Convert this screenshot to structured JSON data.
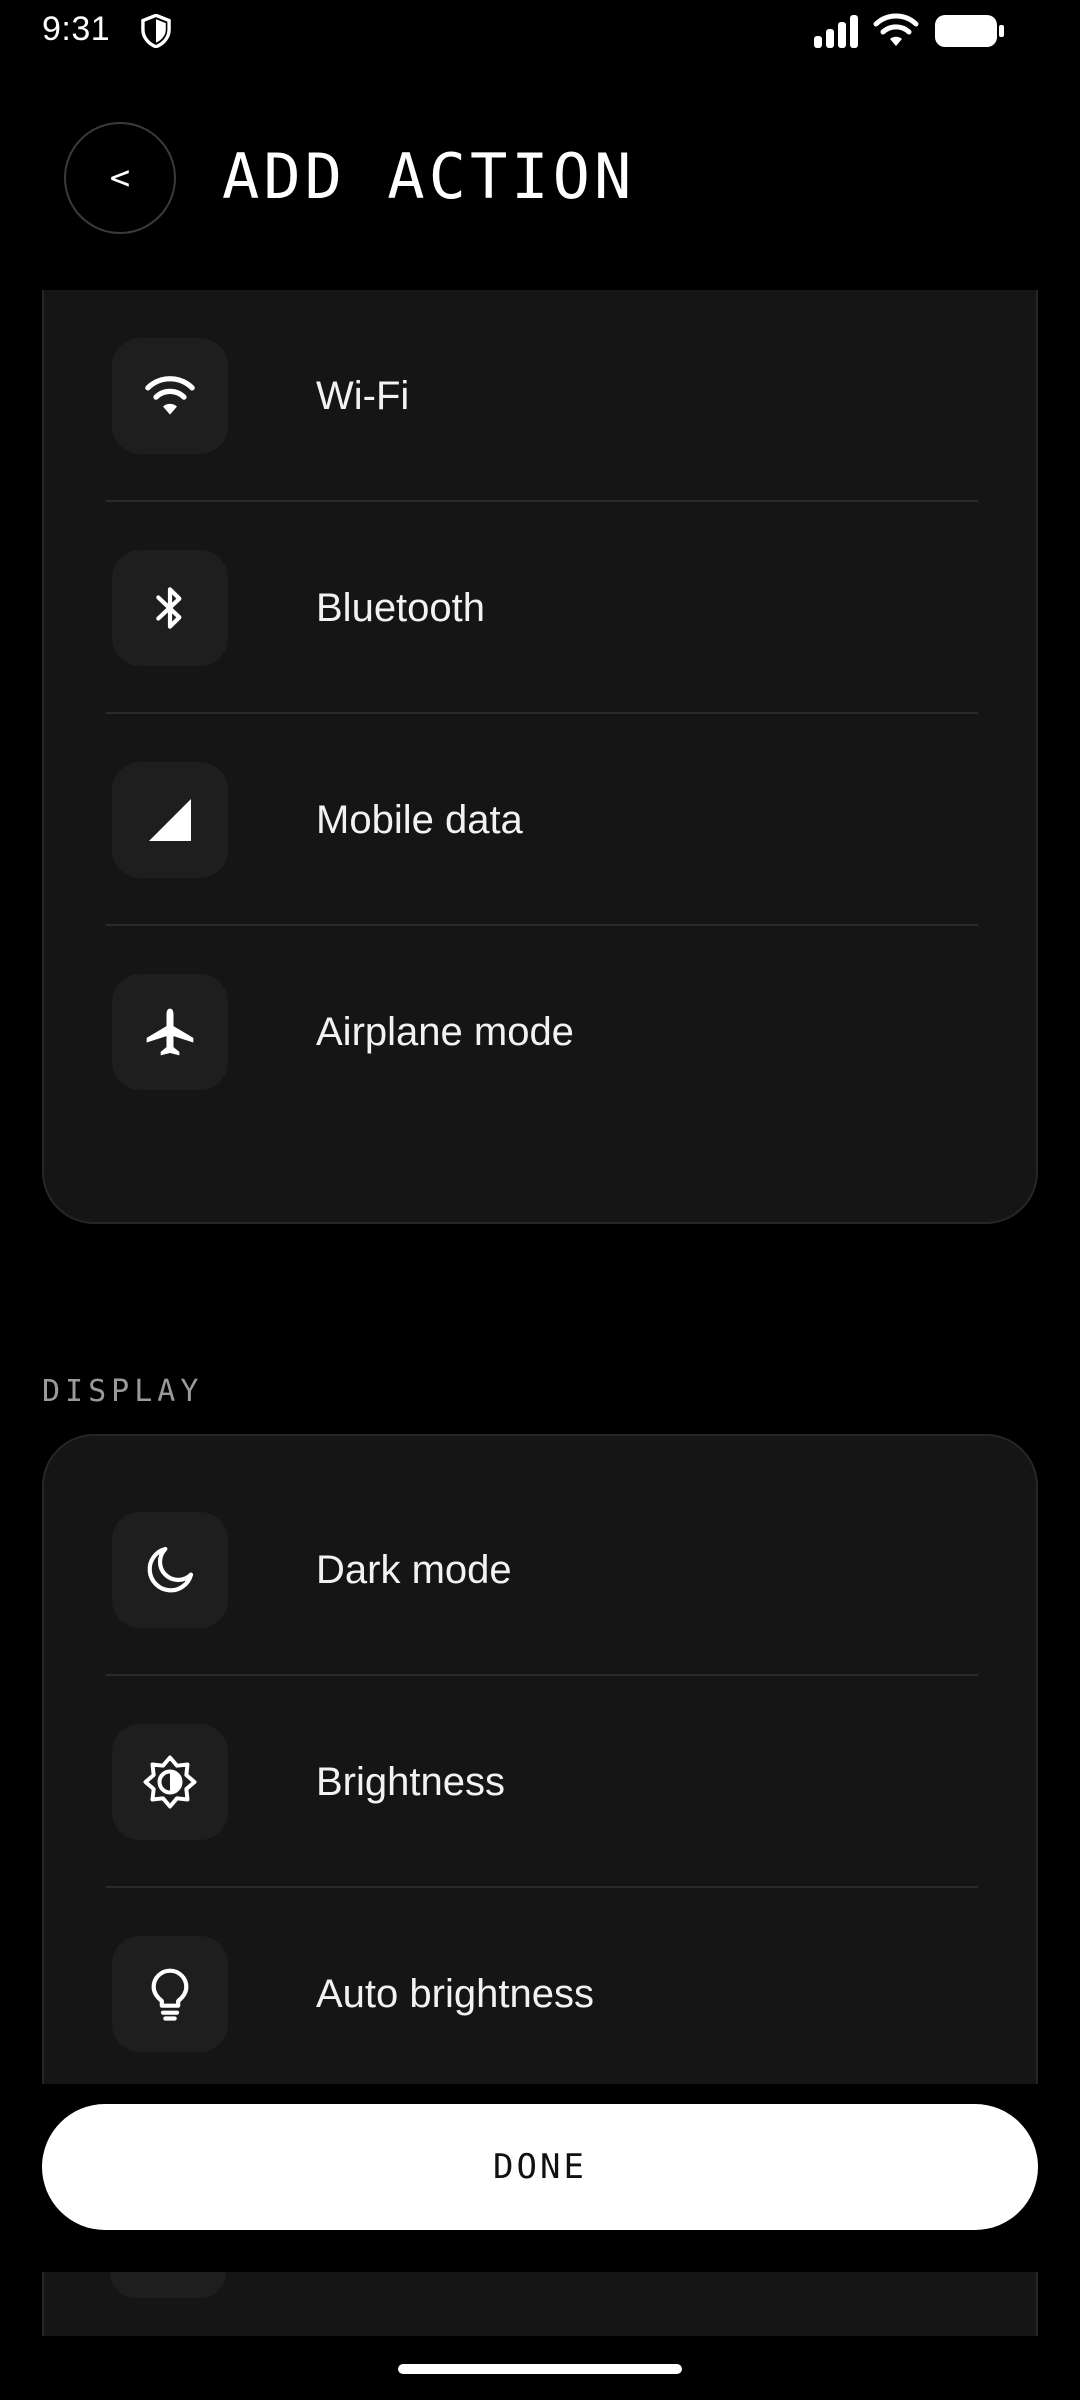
{
  "status_bar": {
    "time": "9:31"
  },
  "header": {
    "back_label": "<",
    "title": "ADD ACTION"
  },
  "sections": {
    "connectivity": {
      "items": [
        {
          "label": "Wi-Fi",
          "icon": "wifi-icon"
        },
        {
          "label": "Bluetooth",
          "icon": "bluetooth-icon"
        },
        {
          "label": "Mobile data",
          "icon": "mobile-data-icon"
        },
        {
          "label": "Airplane mode",
          "icon": "airplane-icon"
        }
      ]
    },
    "display": {
      "label": "DISPLAY",
      "items": [
        {
          "label": "Dark mode",
          "icon": "moon-icon"
        },
        {
          "label": "Brightness",
          "icon": "brightness-icon"
        },
        {
          "label": "Auto brightness",
          "icon": "lightbulb-icon"
        }
      ]
    }
  },
  "footer": {
    "done_label": "DONE"
  },
  "colors": {
    "background": "#000000",
    "card": "#151515",
    "icon_tile": "#1e1e1e",
    "text": "#f2f2f2",
    "muted": "#9a9a9a",
    "button_bg": "#ffffff",
    "button_text": "#111111"
  }
}
